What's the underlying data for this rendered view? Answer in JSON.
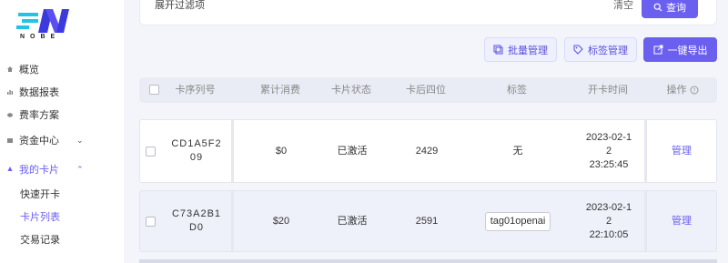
{
  "brand": {
    "logo_text": "NOBE",
    "accent": "#6b5ff0"
  },
  "sidebar": {
    "items": [
      {
        "label": "概览",
        "icon": "home-icon"
      },
      {
        "label": "数据报表",
        "icon": "bar-chart-icon"
      },
      {
        "label": "费率方案",
        "icon": "rate-icon"
      },
      {
        "label": "资金中心",
        "icon": "wallet-icon",
        "chevron": "⌄"
      },
      {
        "label": "我的卡片",
        "icon": "card-icon",
        "chevron": "⌃"
      }
    ],
    "sub_items": [
      {
        "label": "快速开卡"
      },
      {
        "label": "卡片列表"
      },
      {
        "label": "交易记录"
      }
    ]
  },
  "filter": {
    "expand_label": "展开过滤项",
    "clear_label": "清空",
    "query_label": "查询"
  },
  "toolbar": {
    "batch_label": "批量管理",
    "tag_label": "标签管理",
    "export_label": "一键导出"
  },
  "table": {
    "headers": [
      "卡序列号",
      "累计消费",
      "卡片状态",
      "卡后四位",
      "标签",
      "开卡时间",
      "操作"
    ],
    "rows": [
      {
        "serial": "CD1A5F209",
        "spend": "$0",
        "status": "已激活",
        "last4": "2429",
        "tag": "无",
        "date": "2023-02-12",
        "time": "23:25:45",
        "action": "管理"
      },
      {
        "serial": "C73A2B1D0",
        "spend": "$20",
        "status": "已激活",
        "last4": "2591",
        "tag": "tag01openai",
        "date": "2023-02-12",
        "time": "22:10:05",
        "action": "管理"
      }
    ]
  }
}
